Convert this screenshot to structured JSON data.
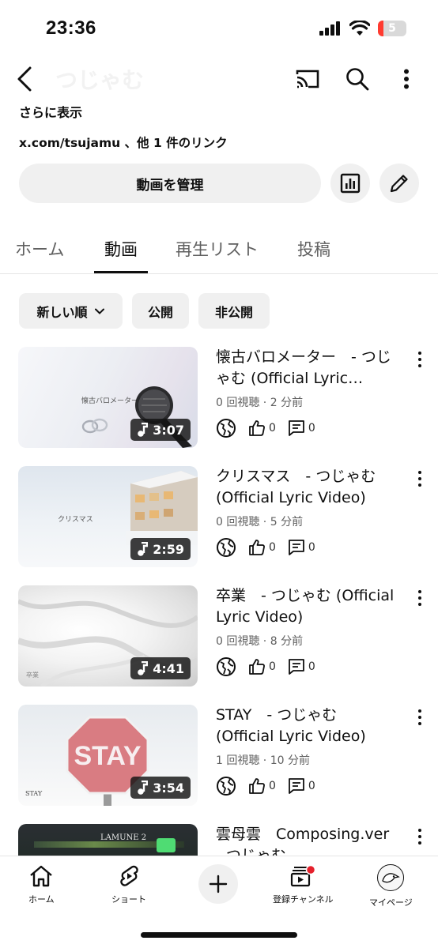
{
  "status_bar": {
    "time": "23:36",
    "battery": "5"
  },
  "header": {
    "channel_name": "つじゃむ"
  },
  "channel": {
    "more_label": "さらに表示",
    "links_text": "x.com/tsujamu 、他 1 件のリンク",
    "manage_label": "動画を管理"
  },
  "tabs": [
    {
      "label": "ホーム"
    },
    {
      "label": "動画"
    },
    {
      "label": "再生リスト"
    },
    {
      "label": "投稿"
    }
  ],
  "filters": {
    "sort_label": "新しい順",
    "public_label": "公開",
    "private_label": "非公開"
  },
  "videos": [
    {
      "title": "懐古バロメーター　- つじゃむ (Official Lyric Video)",
      "meta": "0 回視聴 · 2 分前",
      "duration": "3:07",
      "likes": "0",
      "comments": "0",
      "thumb_text": "懐古バロメーター"
    },
    {
      "title": "クリスマス　- つじゃむ (Official Lyric Video)",
      "meta": "0 回視聴 · 5 分前",
      "duration": "2:59",
      "likes": "0",
      "comments": "0",
      "thumb_text": "クリスマス"
    },
    {
      "title": "卒業　- つじゃむ (Official Lyric Video)",
      "meta": "0 回視聴 · 8 分前",
      "duration": "4:41",
      "likes": "0",
      "comments": "0",
      "thumb_text": "卒業"
    },
    {
      "title": "STAY　- つじゃむ (Official Lyric Video)",
      "meta": "1 回視聴 · 10 分前",
      "duration": "3:54",
      "likes": "0",
      "comments": "0",
      "thumb_text": "STAY"
    },
    {
      "title": "雲母雲　Composing.ver - つじゃむ",
      "thumb_text": "LAMUNE 2"
    }
  ],
  "bottom_nav": {
    "home": "ホーム",
    "shorts": "ショート",
    "subscriptions": "登録チャンネル",
    "mypage": "マイページ"
  },
  "colors": {
    "notification_dot": "#e5202b",
    "battery_low": "#ff3b30"
  }
}
